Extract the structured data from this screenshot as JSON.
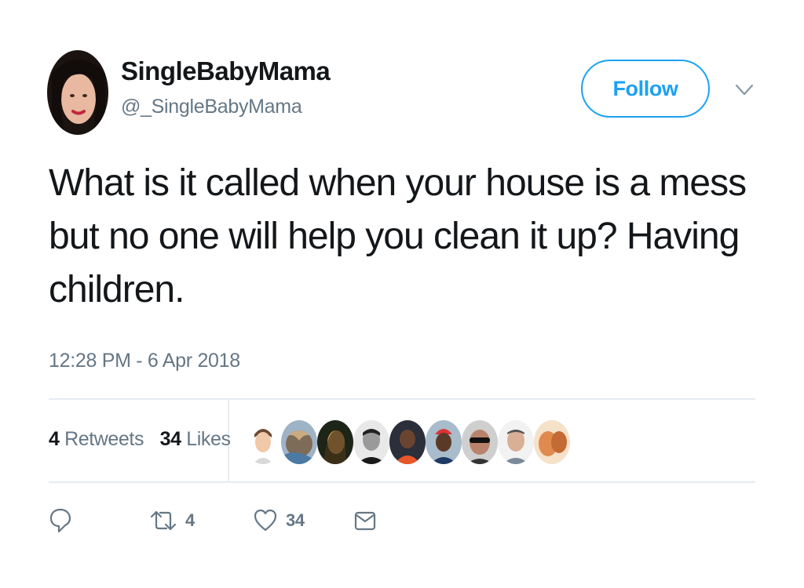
{
  "user": {
    "display_name": "SingleBabyMama",
    "handle": "@_SingleBabyMama"
  },
  "follow_button": {
    "label": "Follow"
  },
  "tweet": {
    "text": "What is it called when your house is a mess but no one will help you clean it up? Having children.",
    "timestamp": "12:28 PM - 6 Apr 2018"
  },
  "stats": {
    "retweets_count": "4",
    "retweets_label": "Retweets",
    "likes_count": "34",
    "likes_label": "Likes"
  },
  "likers_count_shown": 9,
  "actions": {
    "reply_icon": "reply-icon",
    "retweet_icon": "retweet-icon",
    "retweet_count": "4",
    "like_icon": "heart-icon",
    "like_count": "34",
    "dm_icon": "envelope-icon"
  },
  "colors": {
    "accent": "#1da1f2",
    "secondary_text": "#657786",
    "primary_text": "#14171a",
    "divider": "#e6ecf0"
  }
}
